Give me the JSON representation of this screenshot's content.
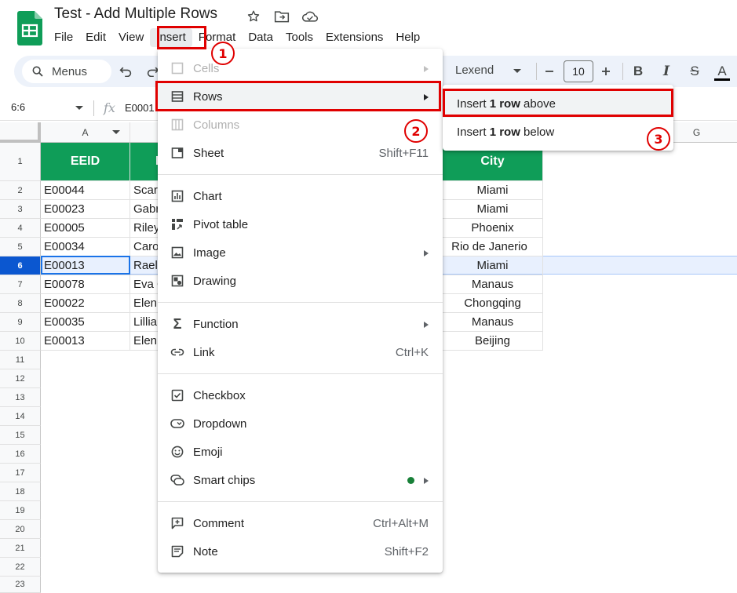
{
  "doc": {
    "title": "Test - Add Multiple Rows"
  },
  "menubar": [
    "File",
    "Edit",
    "View",
    "Insert",
    "Format",
    "Data",
    "Tools",
    "Extensions",
    "Help"
  ],
  "toolbar": {
    "menus_label": "Menus",
    "font": "Lexend",
    "font_size": "10",
    "bold": "B",
    "italic": "I",
    "strike": "S",
    "text_color": "A"
  },
  "formula_bar": {
    "name_box": "6:6",
    "fx": "fx",
    "value": "E0001"
  },
  "grid": {
    "columns": [
      "A",
      "G"
    ],
    "row_numbers": [
      "1",
      "2",
      "3",
      "4",
      "5",
      "6",
      "7",
      "8",
      "9",
      "10",
      "11",
      "12",
      "13",
      "14",
      "15",
      "16",
      "17",
      "18",
      "19",
      "20",
      "21",
      "22",
      "23"
    ],
    "selected_row": "6",
    "header": {
      "a": "EEID",
      "b": "F",
      "city": "City"
    },
    "rows": [
      {
        "eeid": "E00044",
        "name": "Scar",
        "city": "Miami"
      },
      {
        "eeid": "E00023",
        "name": "Gabr",
        "city": "Miami"
      },
      {
        "eeid": "E00005",
        "name": "Riley",
        "city": "Phoenix"
      },
      {
        "eeid": "E00034",
        "name": "Caro",
        "city": "Rio de Janerio"
      },
      {
        "eeid": "E00013",
        "name": "Rael",
        "city": "Miami"
      },
      {
        "eeid": "E00078",
        "name": "Eva C",
        "city": "Manaus"
      },
      {
        "eeid": "E00022",
        "name": "Elen",
        "city": "Chongqing"
      },
      {
        "eeid": "E00035",
        "name": "Lillia",
        "city": "Manaus"
      },
      {
        "eeid": "E00013",
        "name": "Elen",
        "city": "Beijing"
      }
    ]
  },
  "insert_menu": {
    "cells": "Cells",
    "rows": "Rows",
    "columns": "Columns",
    "sheet": "Sheet",
    "sheet_shortcut": "Shift+F11",
    "chart": "Chart",
    "pivot": "Pivot table",
    "image": "Image",
    "drawing": "Drawing",
    "function": "Function",
    "link": "Link",
    "link_shortcut": "Ctrl+K",
    "checkbox": "Checkbox",
    "dropdown": "Dropdown",
    "emoji": "Emoji",
    "smart_chips": "Smart chips",
    "comment": "Comment",
    "comment_shortcut": "Ctrl+Alt+M",
    "note": "Note",
    "note_shortcut": "Shift+F2"
  },
  "rows_submenu": {
    "above": {
      "pre": "Insert ",
      "bold": "1 row",
      "post": " above"
    },
    "below": {
      "pre": "Insert ",
      "bold": "1 row",
      "post": " below"
    }
  },
  "annotations": [
    "1",
    "2",
    "3"
  ],
  "colors": {
    "header_green": "#0f9d58",
    "annotation_red": "#e00000",
    "selection_blue": "#0b57d0"
  }
}
